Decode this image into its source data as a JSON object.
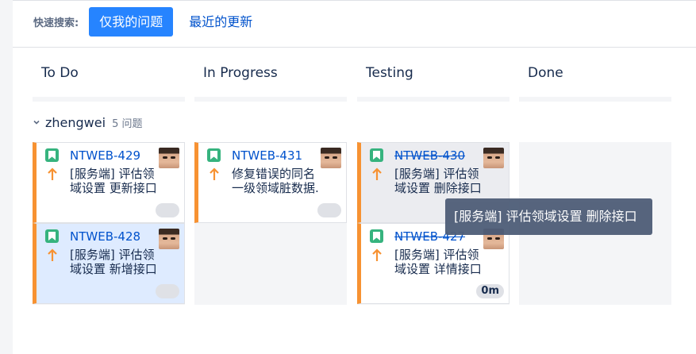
{
  "quick_filters": {
    "label": "快速搜索:",
    "buttons": [
      {
        "label": "仅我的问题",
        "active": true
      },
      {
        "label": "最近的更新",
        "active": false
      }
    ]
  },
  "columns": [
    {
      "title": "To Do"
    },
    {
      "title": "In Progress"
    },
    {
      "title": "Testing"
    },
    {
      "title": "Done"
    }
  ],
  "swimlane": {
    "name": "zhengwei",
    "count": "5 问题"
  },
  "cards": [
    {
      "key": "NTWEB-429",
      "summary": "[服务端] 评估领域设置 更新接口",
      "column": "To Do",
      "strike": false,
      "badge": ""
    },
    {
      "key": "NTWEB-428",
      "summary": "[服务端] 评估领域设置 新增接口",
      "column": "To Do",
      "strike": false,
      "badge": "",
      "highlighted": true
    },
    {
      "key": "NTWEB-431",
      "summary": "修复错误的同名一级领域脏数据.",
      "column": "In Progress",
      "strike": false,
      "badge": ""
    },
    {
      "key": "NTWEB-430",
      "summary": "[服务端] 评估领域设置 删除接口",
      "column": "Testing",
      "strike": true,
      "badge": ""
    },
    {
      "key": "NTWEB-427",
      "summary": "[服务端] 评估领域设置 详情接口",
      "column": "Testing",
      "strike": true,
      "badge": "0m"
    }
  ],
  "tooltip": {
    "text": "[服务端] 评估领域设置 删除接口"
  },
  "colors": {
    "accent": "#2684ff",
    "link": "#0052cc",
    "priority_border": "#f79232",
    "story_icon": "#36b37e",
    "tooltip_bg": "#505f79"
  },
  "icons": {
    "issue_type": "bookmark-icon",
    "priority": "arrow-up-icon",
    "swimlane_toggle": "chevron-down-icon"
  }
}
